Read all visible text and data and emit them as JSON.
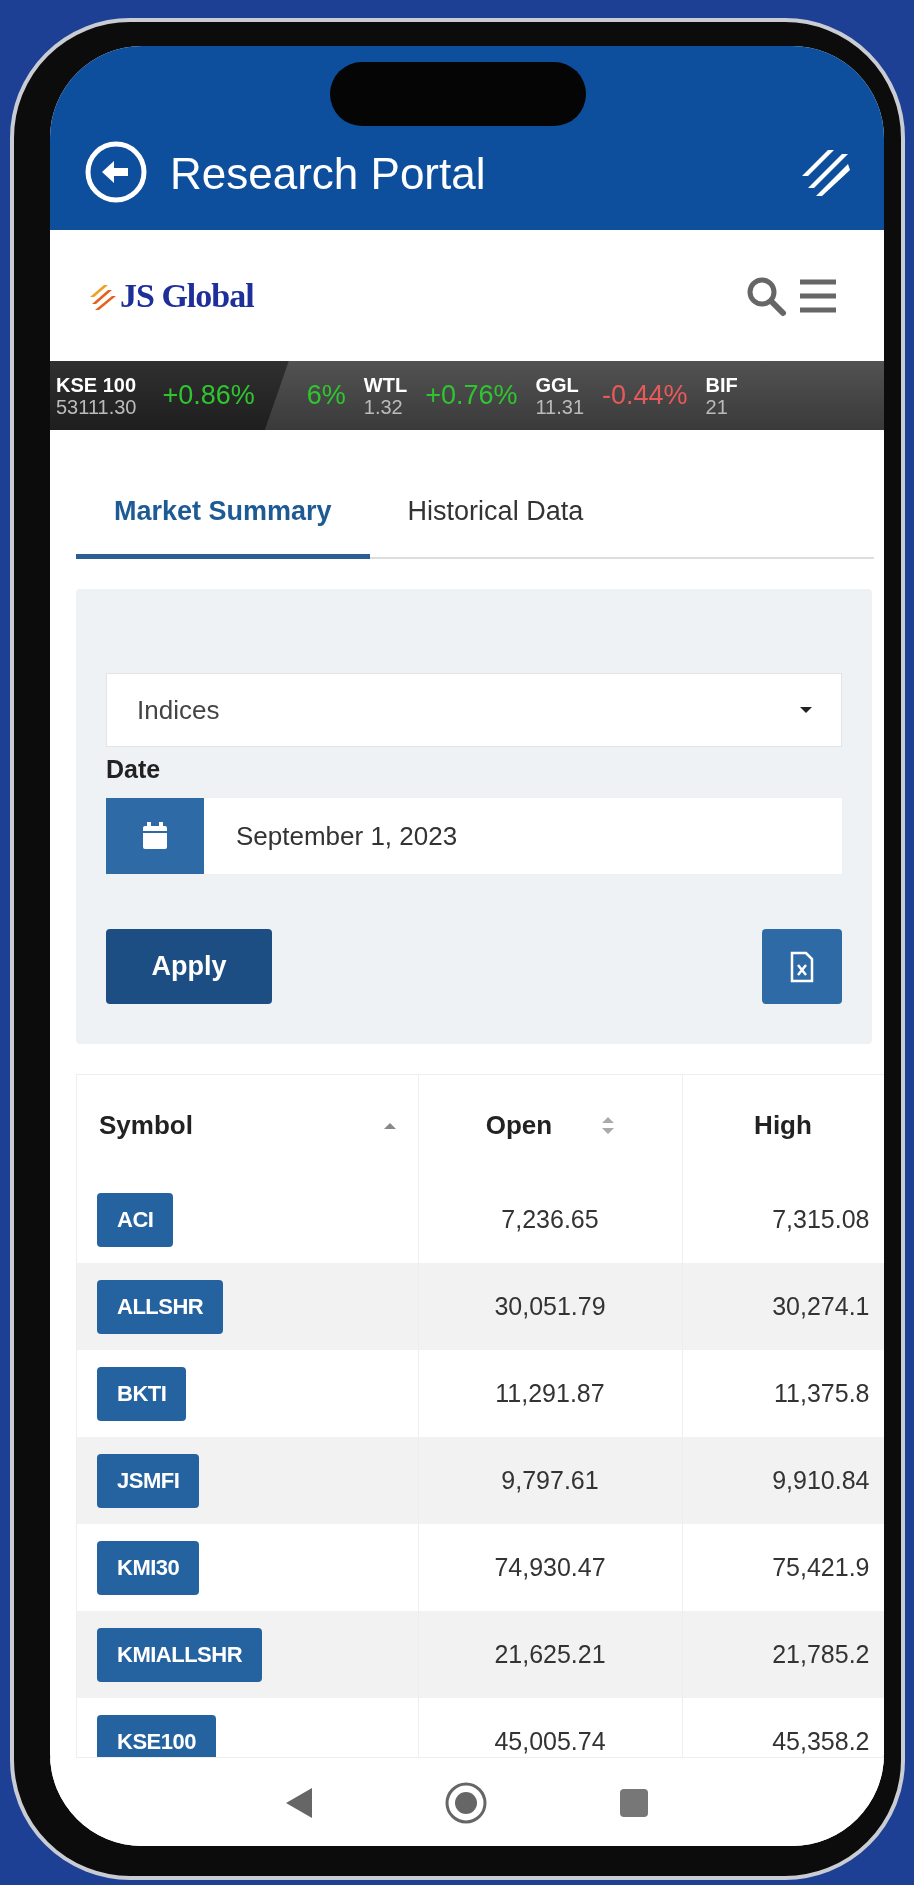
{
  "header": {
    "title": "Research Portal"
  },
  "brand": {
    "name": "JS Global"
  },
  "ticker": [
    {
      "symbol": "KSE 100",
      "price": "53111.30",
      "change": "+0.86%",
      "negative": false
    },
    {
      "change": "6%",
      "negative": false
    },
    {
      "symbol": "WTL",
      "price": "1.32",
      "change": "+0.76%",
      "negative": false
    },
    {
      "symbol": "GGL",
      "price": "11.31",
      "change": "-0.44%",
      "negative": true
    },
    {
      "symbol": "BIF",
      "price": "21"
    }
  ],
  "tabs": [
    {
      "label": "Market Summary",
      "selected": true
    },
    {
      "label": "Historical Data",
      "selected": false
    }
  ],
  "filters": {
    "category": {
      "value": "Indices"
    },
    "date": {
      "label": "Date",
      "value": "September 1, 2023"
    },
    "apply_button": "Apply"
  },
  "table": {
    "columns": [
      {
        "label": "Symbol",
        "sortable": true,
        "sorted": true
      },
      {
        "label": "Open",
        "sortable": true,
        "sorted": false
      },
      {
        "label": "High",
        "sortable": false
      }
    ],
    "rows": [
      [
        "ACI",
        "7,236.65",
        "7,315.08"
      ],
      [
        "ALLSHR",
        "30,051.79",
        "30,274.1"
      ],
      [
        "BKTI",
        "11,291.87",
        "11,375.8"
      ],
      [
        "JSMFI",
        "9,797.61",
        "9,910.84"
      ],
      [
        "KMI30",
        "74,930.47",
        "75,421.9"
      ],
      [
        "KMIALLSHR",
        "21,625.21",
        "21,785.2"
      ],
      [
        "KSE100",
        "45,005.74",
        "45,358.2"
      ]
    ]
  }
}
